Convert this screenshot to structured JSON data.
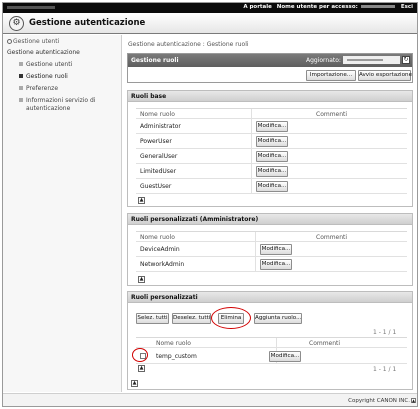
{
  "topbar": {
    "portal_link": "A portale",
    "user_label": "Nome utente per accesso:",
    "logout": "Esci"
  },
  "titlebar": {
    "title": "Gestione autenticazione",
    "logo_icon": "key-gear-icon"
  },
  "sidebar": {
    "top_link": "Gestione utenti",
    "section": "Gestione autenticazione",
    "items": [
      {
        "label": "Gestione utenti",
        "active": false
      },
      {
        "label": "Gestione ruoli",
        "active": true
      },
      {
        "label": "Preferenze",
        "active": false
      },
      {
        "label": "Informazioni servizio di",
        "label2": "autenticazione",
        "active": false
      }
    ]
  },
  "main": {
    "breadcrumb": "Gestione autenticazione : Gestione ruoli",
    "rolebar": {
      "title": "Gestione ruoli",
      "updated_label": "Aggiornato:",
      "import_button": "Importazione...",
      "export_button": "Avvio esportazione"
    },
    "basic_roles": {
      "title": "Ruoli base",
      "col_name": "Nome ruolo",
      "col_comment": "Commenti",
      "rows": [
        "Administrator",
        "PowerUser",
        "GeneralUser",
        "LimitedUser",
        "GuestUser"
      ],
      "edit_label": "Modifica..."
    },
    "custom_admin_roles": {
      "title": "Ruoli personalizzati (Amministratore)",
      "col_name": "Nome ruolo",
      "col_comment": "Commenti",
      "rows": [
        "DeviceAdmin",
        "NetworkAdmin"
      ],
      "edit_label": "Modifica..."
    },
    "custom_roles": {
      "title": "Ruoli personalizzati",
      "select_all": "Selez. tutti",
      "deselect_all": "Deselez. tutti",
      "delete": "Elimina",
      "add_role": "Aggiunta ruolo...",
      "pager_top": "1 - 1 / 1",
      "pager_bottom": "1 - 1 / 1",
      "col_name": "Nome ruolo",
      "col_comment": "Commenti",
      "rows": [
        "temp_custom"
      ],
      "edit_label": "Modifica..."
    }
  },
  "footer": {
    "copyright": "Copyright CANON INC."
  },
  "colors": {
    "topbar": "#0b0b0b",
    "header": "#6a6a6a",
    "highlight": "#d10000"
  }
}
